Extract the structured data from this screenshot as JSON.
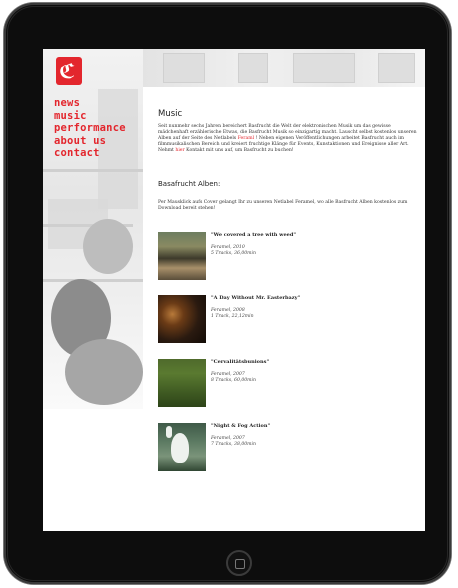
{
  "brand": {
    "accent": "#e3262d",
    "logo": "bandfrucht-logo"
  },
  "nav": {
    "items": [
      {
        "label": "news"
      },
      {
        "label": "music"
      },
      {
        "label": "performance"
      },
      {
        "label": "about us"
      },
      {
        "label": "contact"
      }
    ]
  },
  "main": {
    "title": "Music",
    "intro_before": "Seit nunmehr sechs Jahren bereichert Basfrucht die Welt der elektronischen Musik um das gewisse mädchenhaft erzählerische Etwas, die Basfrucht Musik so einzigartig macht. Lauscht selbst kostenlos unseren Alben auf der Seite des Netlabels ",
    "intro_link1": "Feraml",
    "intro_mid": " ! Neben eigenen Veröffentlichungen arbeitet Basfrucht auch im filmmusikalischen Bereich und kreiert fruchtige Klänge für Events, Kunstaktionen und Ereignisse aller Art. Nehmt ",
    "intro_link2": "hier",
    "intro_after": " Kontakt mit uns auf, um Basfrucht zu buchen!",
    "albums_heading": "Basafrucht Alben:",
    "download_text": "Per Mausklick aufs Cover gelangt Ihr zu unseren Netlabel Feramel, wo alle Basfrucht Alben kostenlos zum Download bereit stehen!"
  },
  "albums": [
    {
      "title": "\"We covered a tree with weed\"",
      "label_year": "Feramel, 2010",
      "tracks": "5 Tracks, 36,00min",
      "cover": "album-cover-tree"
    },
    {
      "title": "\"A Day Without Mr. Easterbazy\"",
      "label_year": "Feramel, 2008",
      "tracks": "1 Track, 22,12min",
      "cover": "album-cover-dark-room"
    },
    {
      "title": "\"Cervalitätsbunions\"",
      "label_year": "Feramel, 2007",
      "tracks": "8 Tracks, 60,00min",
      "cover": "album-cover-green"
    },
    {
      "title": "\"Night & Fog Action\"",
      "label_year": "Feramel, 2007",
      "tracks": "7 Tracks, 38,00min",
      "cover": "album-cover-heron"
    }
  ]
}
